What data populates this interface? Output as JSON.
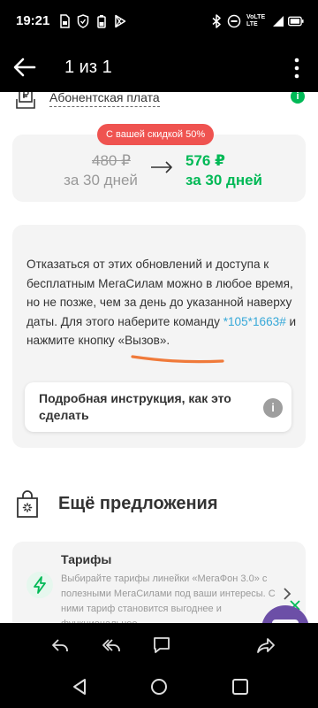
{
  "status_bar": {
    "time": "19:21",
    "network_top": "VoLTE",
    "network_bottom": "LTE",
    "icons": [
      "sim-icon",
      "shield-icon",
      "battery-saver-icon",
      "play-store-icon",
      "bluetooth-icon",
      "do-not-disturb-icon",
      "signal-icon",
      "battery-icon"
    ]
  },
  "app_bar": {
    "title": "1 из 1",
    "back_icon": "arrow-left-icon",
    "menu_icon": "more-vertical-icon"
  },
  "fee": {
    "label": "Абонентская плата",
    "info_glyph": "i"
  },
  "price": {
    "discount_badge": "С вашей скидкой 50%",
    "old_price": "480 ₽",
    "old_period": "за 30 дней",
    "new_price": "576 ₽",
    "new_period": "за 30 дней"
  },
  "info": {
    "text_before": "Отказаться от этих обновлений и доступа к бесплатным МегаСилам можно в любое время, но не позже, чем за день до указанной наверху даты. Для этого наберите команду ",
    "code": "*105*1663#",
    "text_after": " и нажмите кнопку «Вызов».",
    "instruction": "Подробная инструкция, как это сделать",
    "instruction_glyph": "i"
  },
  "more": {
    "title": "Ещё предложения"
  },
  "tariff": {
    "title": "Тарифы",
    "description": "Выбирайте тарифы линейки «МегаФон 3.0» с полезными МегаСилами под ваши интересы. С ними тариф становится выгоднее и функциональнее."
  },
  "colors": {
    "brand_green": "#00b956",
    "discount_red": "#ef5350",
    "link_blue": "#36a8d8",
    "annotation_orange": "#f07a3a",
    "chat_purple": "#6c4fa7"
  },
  "bottom_actions": [
    "reply-icon",
    "reply-all-icon",
    "comment-icon",
    "share-icon"
  ],
  "nav": [
    "back-triangle-icon",
    "home-circle-icon",
    "recents-square-icon"
  ]
}
